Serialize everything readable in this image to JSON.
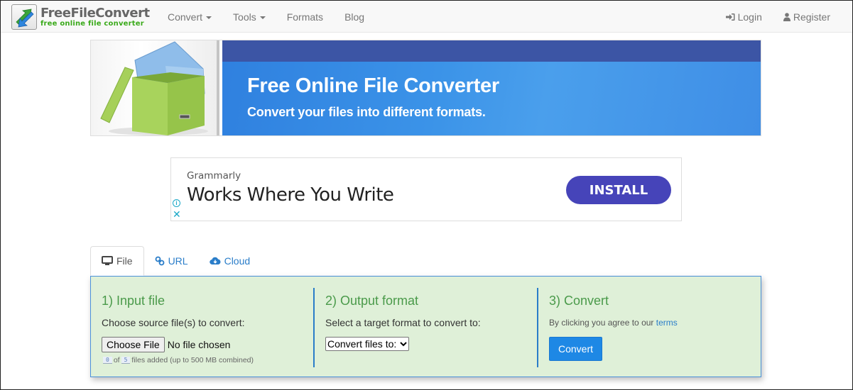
{
  "navbar": {
    "brand_name": "FreeFileConvert",
    "brand_tagline": "free online file converter",
    "left_items": [
      {
        "label": "Convert",
        "has_dropdown": true
      },
      {
        "label": "Tools",
        "has_dropdown": true
      },
      {
        "label": "Formats",
        "has_dropdown": false
      },
      {
        "label": "Blog",
        "has_dropdown": false
      }
    ],
    "right_items": [
      {
        "label": "Login",
        "icon": "sign-in-icon"
      },
      {
        "label": "Register",
        "icon": "user-icon"
      }
    ]
  },
  "hero": {
    "title": "Free Online File Converter",
    "subtitle": "Convert your files into different formats.",
    "image": "green-file-box-with-folder"
  },
  "ad": {
    "advertiser": "Grammarly",
    "headline": "Works Where You Write",
    "cta_label": "INSTALL",
    "info_icon": "ⓘ",
    "close_icon": "✕",
    "cta_color": "#4644b9"
  },
  "tabs": [
    {
      "label": "File",
      "icon": "desktop-icon",
      "active": true
    },
    {
      "label": "URL",
      "icon": "link-icon",
      "active": false
    },
    {
      "label": "Cloud",
      "icon": "cloud-download-icon",
      "active": false
    }
  ],
  "panel": {
    "background": "#dff0d8",
    "input": {
      "title": "1) Input file",
      "description": "Choose source file(s) to convert:",
      "choose_button": "Choose File",
      "file_status": "No file chosen",
      "files_added": "0",
      "files_max": "5",
      "of_label": "of",
      "limit_note": "files added (up to 500 MB combined)"
    },
    "output": {
      "title": "2) Output format",
      "description": "Select a target format to convert to:",
      "select_value": "Convert files to:"
    },
    "convert": {
      "title": "3) Convert",
      "terms_prefix": "By clicking you agree to our",
      "terms_link": "terms",
      "button_label": "Convert",
      "button_color": "#1e88e5"
    }
  }
}
